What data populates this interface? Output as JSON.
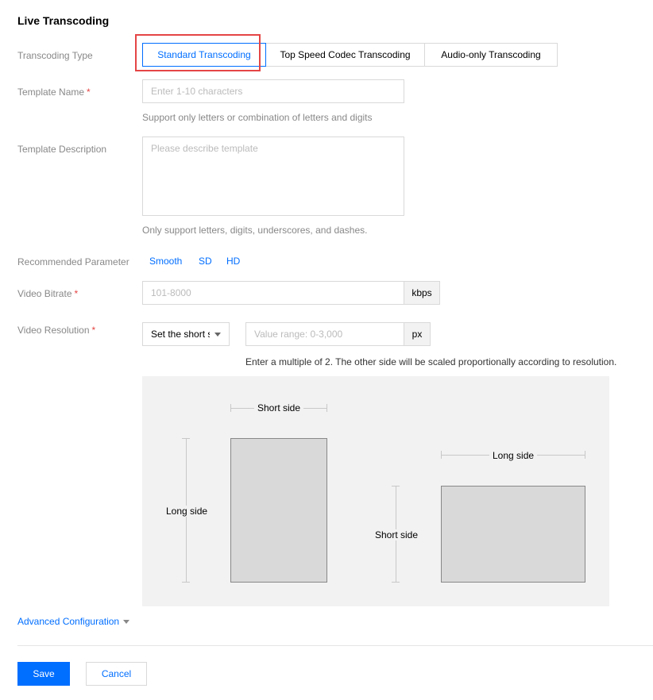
{
  "page": {
    "title": "Live Transcoding"
  },
  "transcoding_type": {
    "label": "Transcoding Type",
    "options": [
      "Standard Transcoding",
      "Top Speed Codec Transcoding",
      "Audio-only Transcoding"
    ],
    "selected": "Standard Transcoding"
  },
  "template_name": {
    "label": "Template Name",
    "required_mark": "*",
    "placeholder": "Enter 1-10 characters",
    "value": "",
    "help": "Support only letters or combination of letters and digits"
  },
  "template_description": {
    "label": "Template Description",
    "placeholder": "Please describe template",
    "value": "",
    "help": "Only support letters, digits, underscores, and dashes."
  },
  "recommended_parameter": {
    "label": "Recommended Parameter",
    "options": [
      "Smooth",
      "SD",
      "HD"
    ]
  },
  "video_bitrate": {
    "label": "Video Bitrate",
    "required_mark": "*",
    "placeholder": "101-8000",
    "value": "",
    "unit": "kbps"
  },
  "video_resolution": {
    "label": "Video Resolution",
    "required_mark": "*",
    "select_value": "Set the short s",
    "placeholder": "Value range: 0-3,000",
    "value": "",
    "unit": "px",
    "help": "Enter a multiple of 2. The other side will be scaled proportionally according to resolution."
  },
  "diagram": {
    "portrait": {
      "top_label": "Short side",
      "side_label": "Long side"
    },
    "landscape": {
      "top_label": "Long side",
      "side_label": "Short side"
    }
  },
  "advanced_configuration": {
    "label": "Advanced Configuration"
  },
  "actions": {
    "save": "Save",
    "cancel": "Cancel"
  },
  "colors": {
    "accent": "#006eff",
    "required": "#e54545",
    "highlight_border": "#e54545"
  },
  "icons": {
    "dropdown_caret": "caret-down-icon"
  }
}
